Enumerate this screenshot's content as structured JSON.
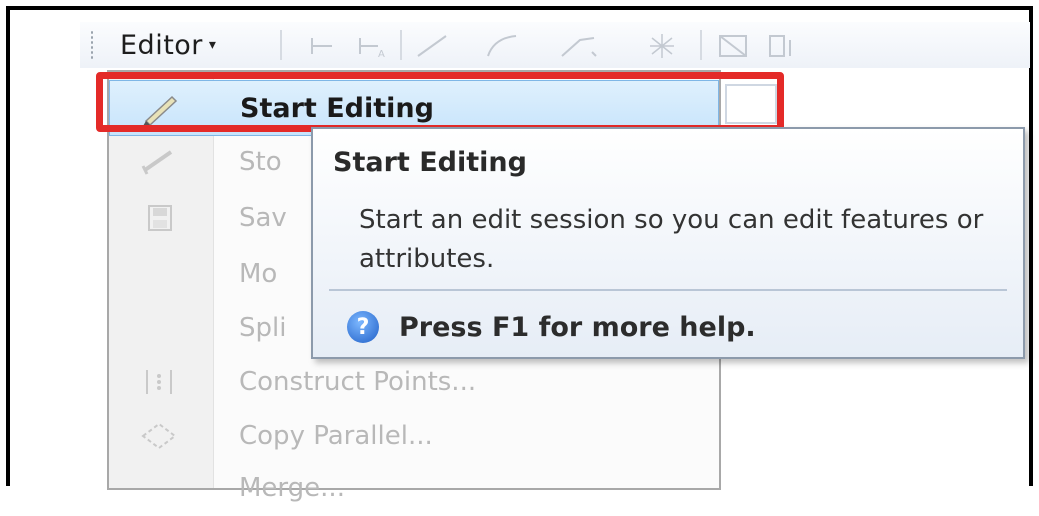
{
  "toolbar": {
    "editor_label": "Editor",
    "editor_caret": "▾",
    "tools": [
      "edit-tool-icon",
      "edit-annotation-tool-icon",
      "straight-segment-icon",
      "arc-segment-icon",
      "trace-icon",
      "snapping-icon",
      "topology-edit-icon",
      "overflow-icon"
    ]
  },
  "menu": {
    "items": [
      {
        "label": "Start Editing",
        "icon": "pencil-icon",
        "enabled": true
      },
      {
        "label": "Sto",
        "icon": "stop-editing-icon",
        "enabled": false
      },
      {
        "label": "Sav",
        "icon": "save-edits-icon",
        "enabled": false
      },
      {
        "label": "Mo",
        "icon": "",
        "enabled": false
      },
      {
        "label": "Spli",
        "icon": "",
        "enabled": false
      },
      {
        "label": "Construct Points...",
        "icon": "construct-points-icon",
        "enabled": false
      },
      {
        "label": "Copy Parallel...",
        "icon": "copy-parallel-icon",
        "enabled": false
      },
      {
        "label": "Merge...",
        "icon": "",
        "enabled": false
      }
    ]
  },
  "tooltip": {
    "title": "Start Editing",
    "body": "Start an edit session so you can edit features or attributes.",
    "help_icon": "?",
    "help_text": "Press F1 for more help."
  },
  "colors": {
    "highlight": "#e42a28",
    "hover_bg": "#c7e4fb",
    "disabled_text": "#b8b8b8"
  }
}
